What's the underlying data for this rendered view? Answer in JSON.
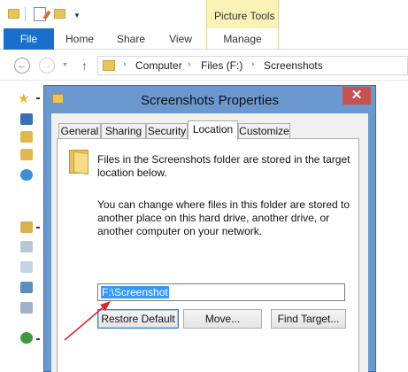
{
  "explorer": {
    "quick_access_icons": [
      "folder-icon",
      "properties-icon",
      "new-folder-icon",
      "customize-arrow-icon"
    ],
    "context_tab_group": "Picture Tools",
    "ribbon_tabs": [
      "File",
      "Home",
      "Share",
      "View",
      "Manage"
    ],
    "nav": {
      "back_icon": "back-arrow-icon",
      "forward_icon": "forward-arrow-icon",
      "up_icon": "up-arrow-icon"
    },
    "breadcrumb": [
      "Computer",
      "Files (F:)",
      "Screenshots"
    ]
  },
  "dialog": {
    "title": "Screenshots Properties",
    "close_label": "✕",
    "tabs": [
      "General",
      "Sharing",
      "Security",
      "Location",
      "Customize"
    ],
    "active_tab": "Location",
    "info_text": "Files in the Screenshots folder are stored in the target location below.",
    "help_text": "You can change where files in this folder are stored to another place on this hard drive, another drive, or another computer on your network.",
    "path_value": "F:\\Screenshot",
    "buttons": {
      "restore_default": "Restore Default",
      "move": "Move...",
      "find_target": "Find Target..."
    }
  },
  "colors": {
    "file_tab": "#1a6fcd",
    "context_tab": "#fbf2b7",
    "dialog_frame": "#6a98cf",
    "close_button": "#c75050",
    "selection": "#3399ff",
    "annotation_arrow": "#d22b2b"
  }
}
